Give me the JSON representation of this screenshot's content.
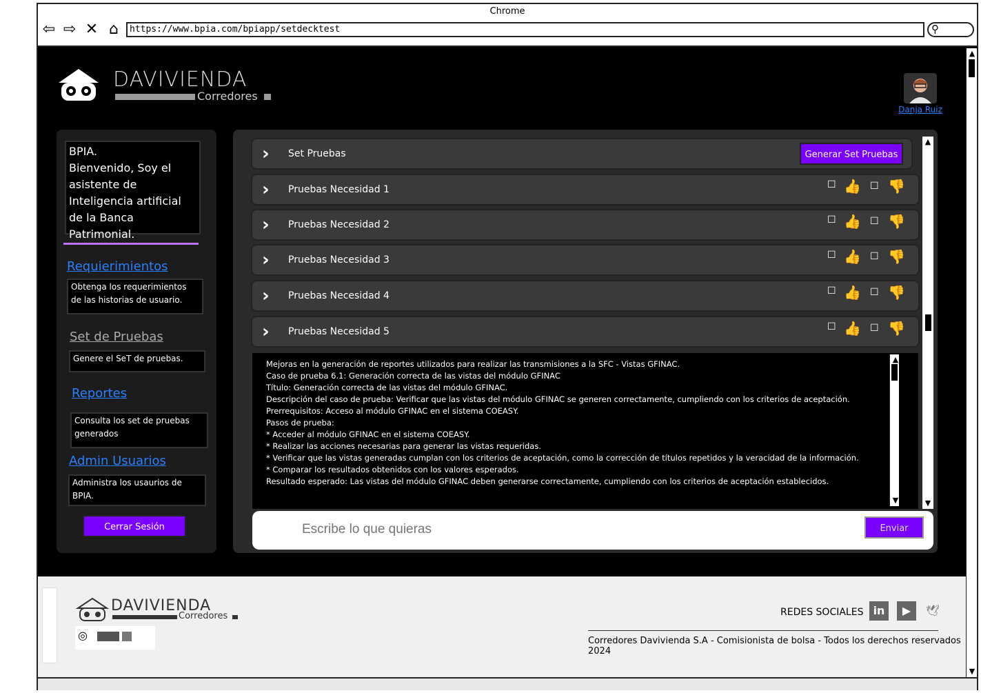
{
  "browser": {
    "title": "Chrome",
    "url": "https://www.bpia.com/bpiapp/setdecktest",
    "nav_icons": [
      "back-icon",
      "forward-icon",
      "close-icon",
      "home-icon"
    ]
  },
  "header": {
    "brand": "DAVIVIENDA",
    "brand_sub": "Corredores",
    "user_name": "Danja Ruiz"
  },
  "sidebar": {
    "intro": "BPIA.\nBienvenido, Soy el asistente de Inteligencia artificial de la Banca Patrimonial.",
    "items": [
      {
        "label": "Requierimientos",
        "desc": "Obtenga los requerimientos de las historias de usuario."
      },
      {
        "label": "Set de Pruebas",
        "desc": "Genere el SeT de pruebas."
      },
      {
        "label": "Reportes",
        "desc": "Consulta los set de pruebas generados"
      },
      {
        "label": "Admin Usuarios",
        "desc": "Administra los usaurios de BPIA."
      }
    ],
    "logout_label": "Cerrar Sesión"
  },
  "main": {
    "set_title": "Set Pruebas",
    "generate_label": "Generar Set Pruebas",
    "accordions": [
      {
        "label": "Pruebas Necesidad 1"
      },
      {
        "label": "Pruebas Necesidad 2"
      },
      {
        "label": "Pruebas Necesidad 3"
      },
      {
        "label": "Pruebas Necesidad 4"
      },
      {
        "label": "Pruebas Necesidad 5"
      }
    ],
    "result_lines": [
      "Mejoras en la generación de reportes utilizados para realizar las transmisiones a la SFC - Vistas GFINAC.",
      "Caso de prueba 6.1: Generación correcta de las vistas del módulo GFINAC",
      "Título: Generación correcta de las vistas del módulo GFINAC.",
      "Descripción del caso de prueba: Verificar que las vistas del módulo GFINAC se generen correctamente, cumpliendo con los criterios de aceptación.",
      "Prerrequisitos: Acceso al módulo GFINAC en el sistema COEASY.",
      "Pasos de prueba:",
      "* Acceder al módulo GFINAC en el sistema COEASY.",
      "* Realizar las acciones necesarias para generar las vistas requeridas.",
      "* Verificar que las vistas generadas cumplan con los criterios de aceptación, como la corrección de títulos repetidos y la veracidad de la información.",
      "* Comparar los resultados obtenidos con los valores esperados.",
      "Resultado esperado: Las vistas del módulo GFINAC deben generarse correctamente, cumpliendo con los criterios de aceptación establecidos."
    ],
    "chat_placeholder": "Escribe lo que quieras",
    "send_label": "Enviar"
  },
  "footer": {
    "brand": "DAVIVIENDA",
    "brand_sub": "Corredores",
    "social_title": "REDES SOCIALES",
    "social_icons": [
      "linkedin-icon",
      "youtube-icon",
      "twitter-icon"
    ],
    "copyright": "Corredores Davivienda S.A - Comisionista de bolsa - Todos los derechos reservados 2024"
  },
  "colors": {
    "accent": "#7a00ff",
    "link": "#2a7fff",
    "highlight": "#c070ff"
  }
}
